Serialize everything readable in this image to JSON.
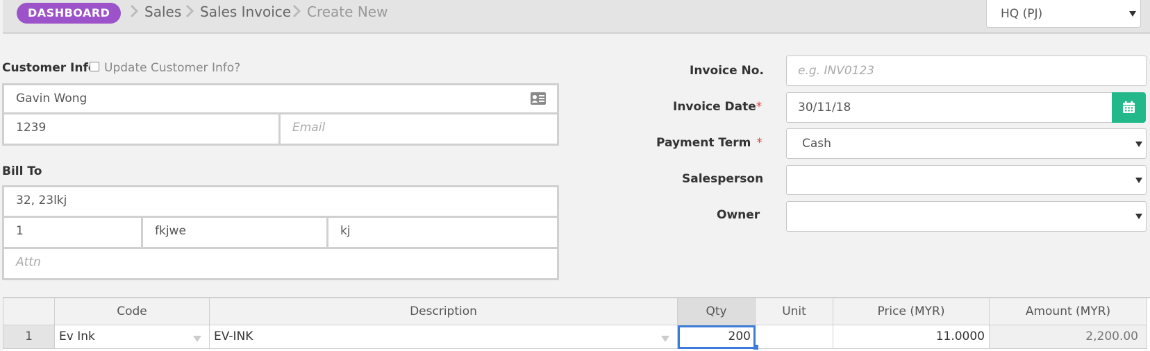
{
  "breadcrumb": {
    "dashboard": "DASHBOARD",
    "items": [
      "Sales",
      "Sales Invoice",
      "Create New"
    ]
  },
  "branch": {
    "selected": "HQ (PJ)"
  },
  "customer": {
    "section_label": "Customer Info",
    "update_label": "Update Customer Info?",
    "update_checked": false,
    "name": "Gavin Wong",
    "phone": "1239",
    "email_placeholder": "Email",
    "contact_card_icon": "contact-card-icon"
  },
  "bill_to": {
    "section_label": "Bill To",
    "address1": "32, 23lkj",
    "postcode": "1",
    "city": "fkjwe",
    "state": "kj",
    "attn_placeholder": "Attn"
  },
  "invoice": {
    "no_label": "Invoice No.",
    "no_placeholder": "e.g. INV0123",
    "date_label": "Invoice Date",
    "date_value": "30/11/18",
    "payment_term_label": "Payment Term",
    "payment_term_value": "Cash",
    "salesperson_label": "Salesperson",
    "salesperson_value": "",
    "owner_label": "Owner",
    "owner_value": "",
    "required_mark": "*",
    "calendar_icon": "calendar-icon"
  },
  "grid": {
    "headers": [
      "",
      "Code",
      "Description",
      "Qty",
      "Unit",
      "Price (MYR)",
      "Amount (MYR)"
    ],
    "rows": [
      {
        "index": "1",
        "code": "Ev Ink",
        "description": "EV-INK",
        "qty": "200",
        "unit": "",
        "price": "11.0000",
        "amount": "2,200.00"
      }
    ]
  },
  "colors": {
    "badge": "#9c53c9",
    "calendar_button": "#22b88a",
    "required": "#e03c3c",
    "focus": "#3b7cd8"
  }
}
